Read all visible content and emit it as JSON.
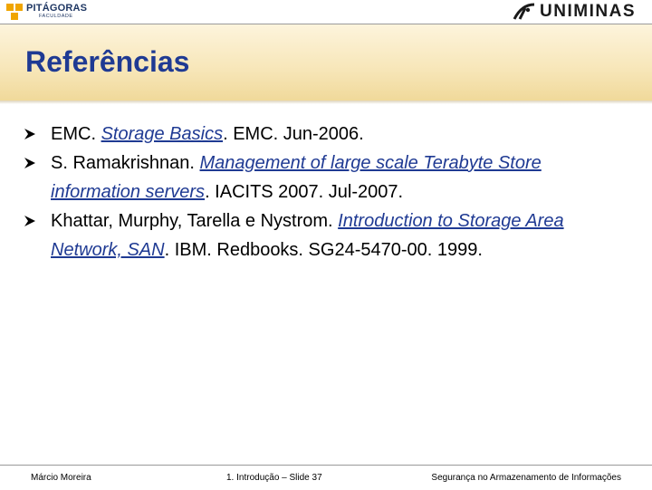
{
  "header": {
    "left_logo": {
      "name": "PITÁGORAS",
      "subtitle": "FACULDADE",
      "color": "#1f3763",
      "accent": "#f0a500"
    },
    "right_logo": {
      "name": "UNIMINAS"
    }
  },
  "slide": {
    "title": "Referências",
    "references": [
      {
        "pre": "EMC. ",
        "title": "Storage Basics",
        "post": ". EMC. Jun-2006."
      },
      {
        "pre": "S. Ramakrishnan. ",
        "title": "Management of large scale Terabyte Store information servers",
        "post": ". IACITS 2007. Jul-2007."
      },
      {
        "pre": "Khattar, Murphy, Tarella e Nystrom. ",
        "title": "Introduction to Storage Area Network, SAN",
        "post": ". IBM. Redbooks. SG24-5470-00. 1999."
      }
    ],
    "bullet_icon": "arrow-bullet-icon"
  },
  "footer": {
    "author": "Márcio Moreira",
    "slide_ref": "1. Introdução – Slide 37",
    "course": "Segurança no Armazenamento de Informações"
  },
  "colors": {
    "title": "#1f3a93",
    "band": "#f7e6b8"
  }
}
